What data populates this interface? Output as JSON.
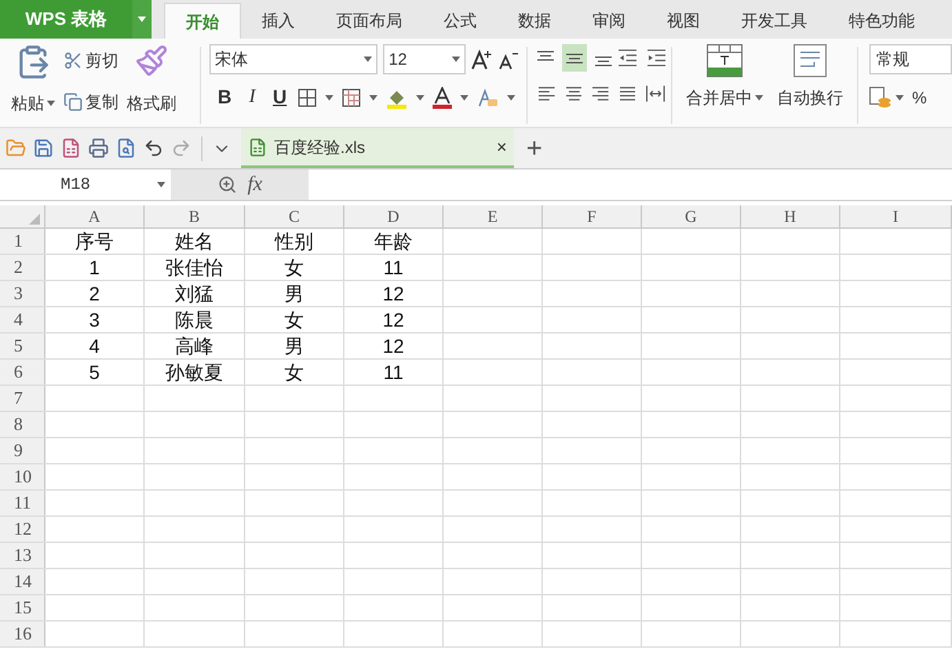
{
  "app_button": {
    "label": "WPS 表格"
  },
  "tabs": [
    {
      "label": "开始",
      "selected": true
    },
    {
      "label": "插入",
      "selected": false
    },
    {
      "label": "页面布局",
      "selected": false
    },
    {
      "label": "公式",
      "selected": false
    },
    {
      "label": "数据",
      "selected": false
    },
    {
      "label": "审阅",
      "selected": false
    },
    {
      "label": "视图",
      "selected": false
    },
    {
      "label": "开发工具",
      "selected": false
    },
    {
      "label": "特色功能",
      "selected": false
    }
  ],
  "ribbon": {
    "paste": "粘贴",
    "cut": "剪切",
    "copy": "复制",
    "format_painter": "格式刷",
    "font": "宋体",
    "font_size": "12",
    "style_buttons": [
      "B",
      "I",
      "U"
    ],
    "align_top": [
      {
        "selected": false
      },
      {
        "selected": true
      },
      {
        "selected": false
      }
    ],
    "merge": "合并居中",
    "wrap": "自动换行",
    "number_format": "常规",
    "percent": "%"
  },
  "document_tab": {
    "title": "百度经验.xls",
    "close": "×",
    "new_tab": "+"
  },
  "formula_bar": {
    "name_box": "M18",
    "fx": "fx"
  },
  "sheet": {
    "columns": [
      "A",
      "B",
      "C",
      "D",
      "E",
      "F",
      "G",
      "H",
      "I"
    ],
    "rows": [
      [
        "序号",
        "姓名",
        "性别",
        "年龄"
      ],
      [
        "1",
        "张佳怡",
        "女",
        "11"
      ],
      [
        "2",
        "刘猛",
        "男",
        "12"
      ],
      [
        "3",
        "陈晨",
        "女",
        "12"
      ],
      [
        "4",
        "高峰",
        "男",
        "12"
      ],
      [
        "5",
        "孙敏夏",
        "女",
        "11"
      ]
    ],
    "row_numbers": [
      "1",
      "2",
      "3",
      "4",
      "5",
      "6",
      "7",
      "8",
      "9",
      "10",
      "11",
      "12",
      "13",
      "14",
      "15",
      "16"
    ]
  }
}
